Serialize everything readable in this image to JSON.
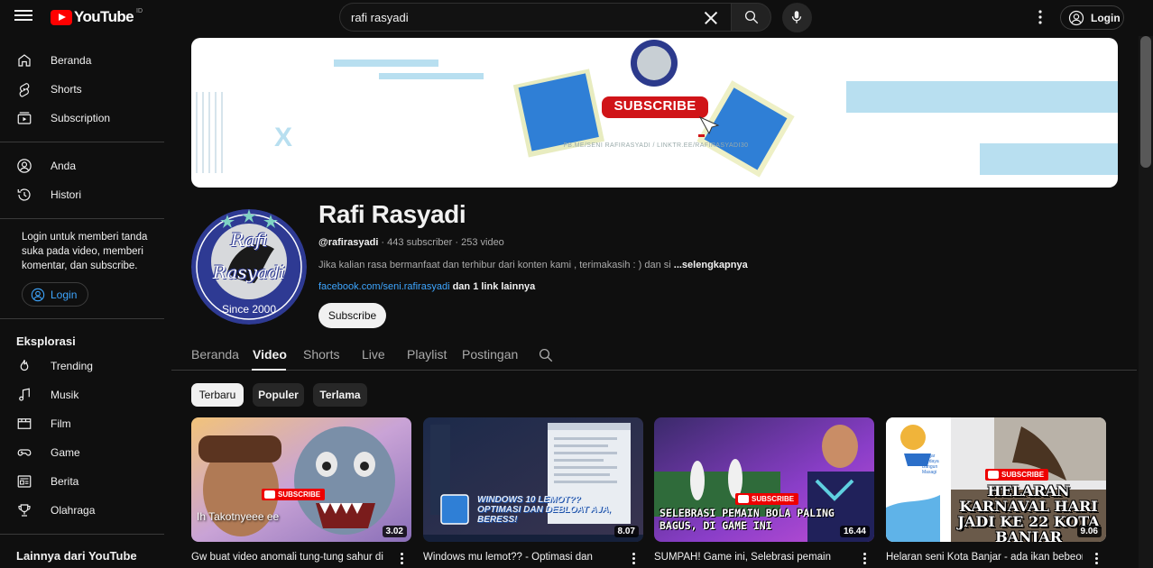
{
  "header": {
    "logo_text": "YouTube",
    "country_code": "ID",
    "search_value": "rafi rasyadi",
    "login_label": "Login"
  },
  "sidebar": {
    "main": [
      {
        "label": "Beranda",
        "icon": "home-icon"
      },
      {
        "label": "Shorts",
        "icon": "shorts-icon"
      },
      {
        "label": "Subscription",
        "icon": "subscriptions-icon"
      }
    ],
    "you": [
      {
        "label": "Anda",
        "icon": "user-icon"
      },
      {
        "label": "Histori",
        "icon": "history-icon"
      }
    ],
    "login_prompt": "Login untuk memberi tanda suka pada video, memberi komentar, dan subscribe.",
    "login_label": "Login",
    "explore_heading": "Eksplorasi",
    "explore": [
      {
        "label": "Trending",
        "icon": "trending-icon"
      },
      {
        "label": "Musik",
        "icon": "music-icon"
      },
      {
        "label": "Film",
        "icon": "film-icon"
      },
      {
        "label": "Game",
        "icon": "game-icon"
      },
      {
        "label": "Berita",
        "icon": "news-icon"
      },
      {
        "label": "Olahraga",
        "icon": "trophy-icon"
      }
    ],
    "more_heading": "Lainnya dari YouTube"
  },
  "banner": {
    "subscribe_text": "SUBSCRIBE",
    "footer_text": "FB.ME/SENI RAFIRASYADI / LINKTR.EE/RAFIRASYADI30",
    "x_mark": "X"
  },
  "channel": {
    "name": "Rafi Rasyadi",
    "handle": "@rafirasyadi",
    "subscribers": "443 subscriber",
    "videos": "253 video",
    "description": "Jika kalian rasa bermanfaat dan terhibur dari konten kami , terimakasih : ) dan si",
    "more_label": "...selengkapnya",
    "link": "facebook.com/seni.rafirasyadi",
    "link_more": "dan 1 link lainnya",
    "subscribe_label": "Subscribe",
    "avatar_line1": "Rafi",
    "avatar_line2": "Rasyadi",
    "avatar_line3": "Since 2000"
  },
  "tabs": [
    "Beranda",
    "Video",
    "Shorts",
    "Live",
    "Playlist",
    "Postingan"
  ],
  "active_tab": "Video",
  "chips": [
    "Terbaru",
    "Populer",
    "Terlama"
  ],
  "active_chip": "Terbaru",
  "videos": [
    {
      "title": "Gw buat video anomali tung-tung sahur di",
      "duration": "3.02",
      "overlay": "Ih Takotnyeee ee",
      "badge": "SUBSCRIBE"
    },
    {
      "title": "Windows mu lemot?? - Optimasi dan",
      "duration": "8.07",
      "overlay": "WINDOWS 10 LEMOT?? OPTIMASI DAN DEBLOAT AJA, BERESS!",
      "badge": ""
    },
    {
      "title": "SUMPAH! Game ini, Selebrasi pemain",
      "duration": "16.44",
      "overlay": "SELEBRASI PEMAIN BOLA PALING BAGUS, DI GAME INI",
      "badge": "SUBSCRIBE"
    },
    {
      "title": "Helaran seni Kota Banjar - ada ikan bebeong",
      "duration": "9.06",
      "overlay": "HELARAN KARNAVAL HARI JADI KE 22 KOTA BANJAR",
      "badge": "SUBSCRIBE",
      "extra": "Banjar Berdaya Bangun Masagi"
    }
  ]
}
